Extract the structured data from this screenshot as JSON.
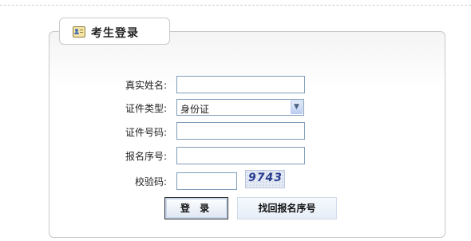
{
  "tab": {
    "title": "考生登录",
    "icon": "id-card-icon"
  },
  "form": {
    "real_name": {
      "label": "真实姓名:",
      "value": ""
    },
    "id_type": {
      "label": "证件类型:",
      "selected": "身份证"
    },
    "id_number": {
      "label": "证件号码:",
      "value": ""
    },
    "reg_number": {
      "label": "报名序号:",
      "value": ""
    },
    "captcha": {
      "label": "校验码:",
      "value": "",
      "code": "9743"
    }
  },
  "buttons": {
    "login": "登 录",
    "find_reg": "找回报名序号"
  }
}
